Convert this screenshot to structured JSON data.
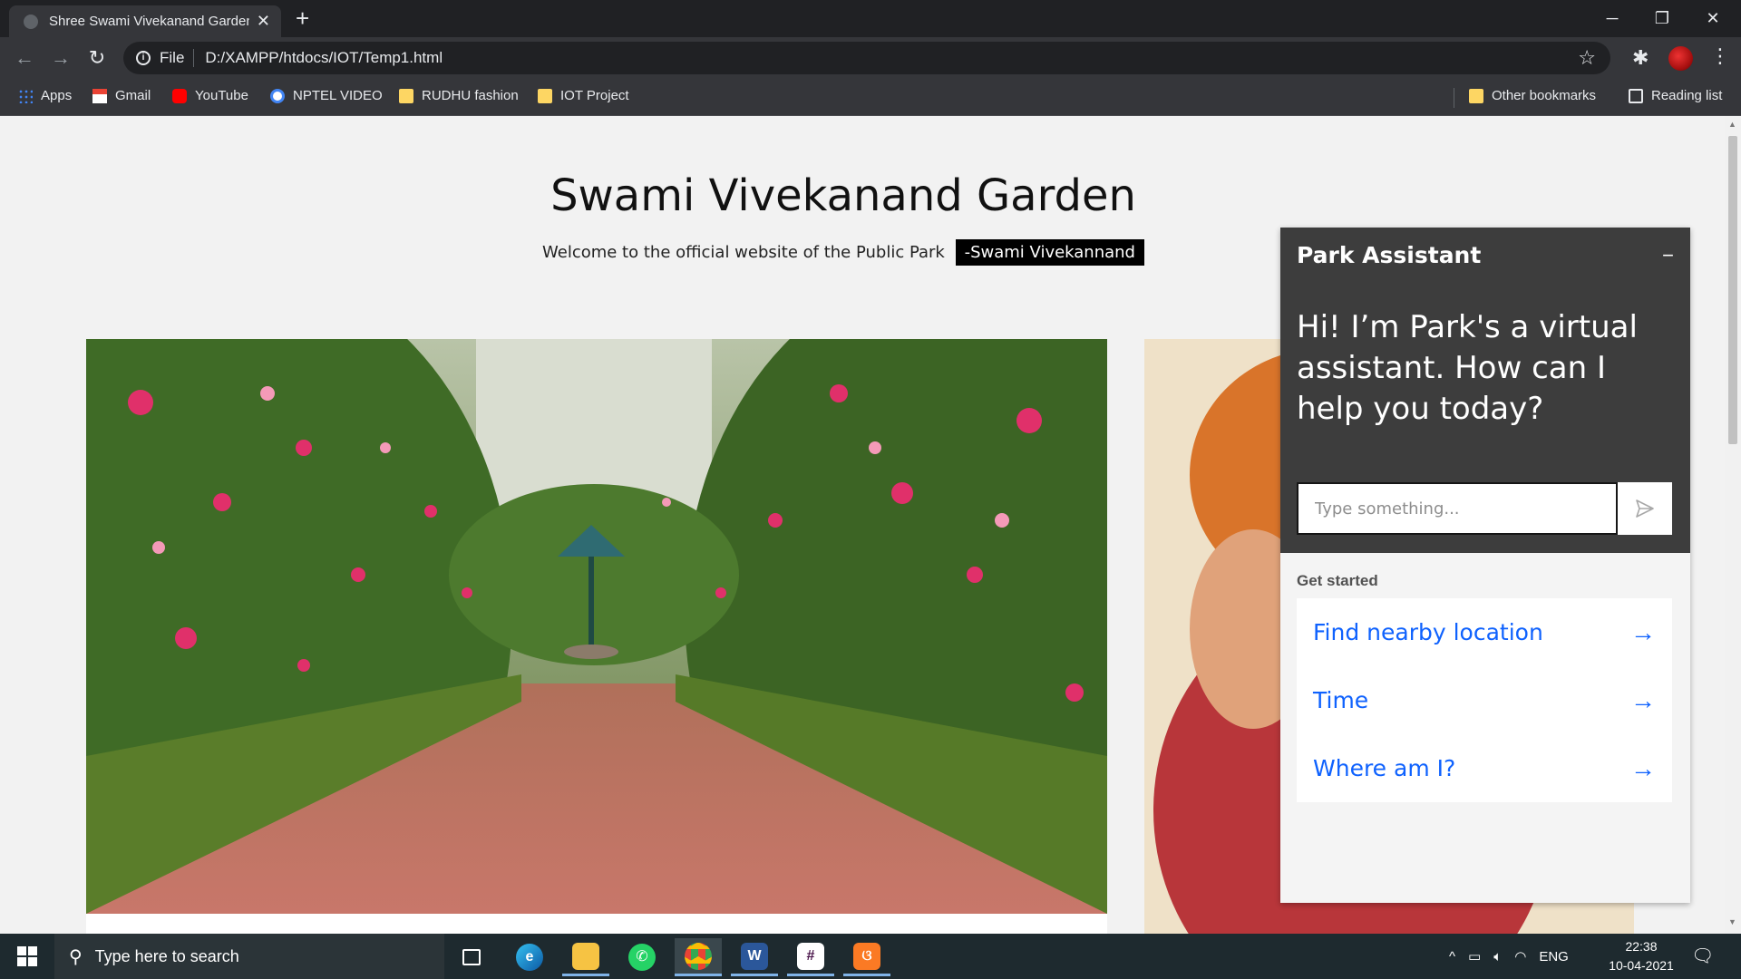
{
  "browser": {
    "tab_title": "Shree Swami Vivekanand Garden",
    "tab_close": "✕",
    "new_tab": "+",
    "scheme_label": "File",
    "url": "D:/XAMPP/htdocs/IOT/Temp1.html",
    "window_controls": {
      "minimize": "─",
      "restore": "❐",
      "close": "✕"
    },
    "nav": {
      "back": "←",
      "forward": "→",
      "reload": "↻"
    },
    "star": "☆",
    "menu": "⋮"
  },
  "bookmarks": {
    "items": [
      {
        "label": "Apps",
        "icon": "apps-grid-icon"
      },
      {
        "label": "Gmail",
        "icon": "gmail-icon"
      },
      {
        "label": "YouTube",
        "icon": "youtube-icon"
      },
      {
        "label": "NPTEL VIDEO",
        "icon": "google-icon"
      },
      {
        "label": "RUDHU fashion",
        "icon": "folder-icon"
      },
      {
        "label": "IOT Project",
        "icon": "folder-icon"
      }
    ],
    "other": "Other bookmarks",
    "reading_list": "Reading list"
  },
  "page": {
    "title": "Swami Vivekanand Garden",
    "subtitle": "Welcome to the official website of the Public Park",
    "quote": "-Swami Vivekannand"
  },
  "chat": {
    "title": "Park Assistant",
    "minimize": "−",
    "greeting": "Hi! I’m Park's a virtual assistant. How can I help you today?",
    "input_placeholder": "Type something...",
    "get_started": "Get started",
    "options": [
      {
        "label": "Find nearby location",
        "arrow": "→"
      },
      {
        "label": "Time",
        "arrow": "→"
      },
      {
        "label": "Where am I?",
        "arrow": "→"
      }
    ]
  },
  "taskbar": {
    "search_placeholder": "Type here to search",
    "language": "ENG",
    "time": "22:38",
    "date": "10-04-2021",
    "apps": [
      "task-view",
      "edge",
      "file-explorer",
      "whatsapp",
      "chrome",
      "word",
      "slack",
      "xampp"
    ]
  },
  "colors": {
    "chat_header": "#3d3d3d",
    "chat_link": "#0f62fe",
    "browser_dark": "#202124",
    "browser_toolbar": "#35363a",
    "taskbar": "#1e2a2f"
  }
}
